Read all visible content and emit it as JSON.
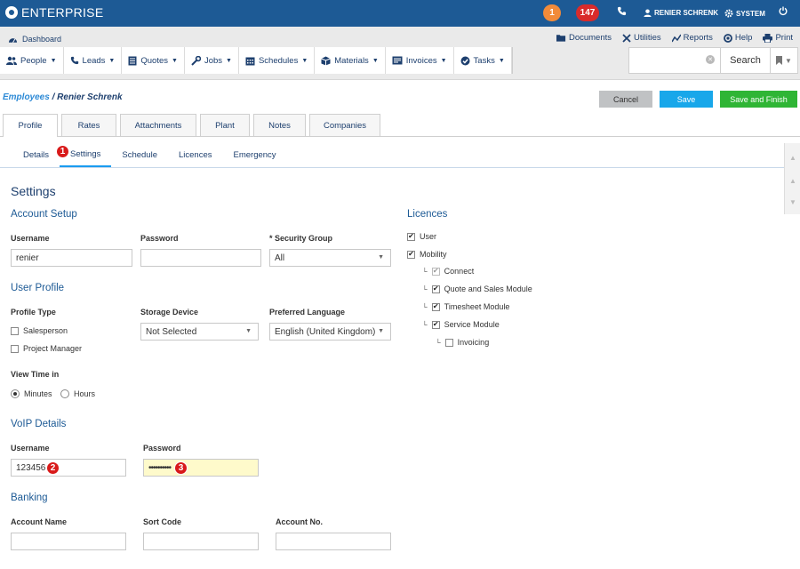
{
  "topbar": {
    "logo_text": "ENTERPRISE",
    "badge_orange": "1",
    "badge_red": "147",
    "user_name": "RENIER SCHRENK",
    "system_label": "SYSTEM",
    "colors": {
      "bar": "#1d5a95",
      "orange": "#f28b3a",
      "red": "#d92b2b"
    }
  },
  "toolbar": {
    "dashboard": "Dashboard",
    "links": [
      "Documents",
      "Utilities",
      "Reports",
      "Help",
      "Print"
    ],
    "nav": [
      "People",
      "Leads",
      "Quotes",
      "Jobs",
      "Schedules",
      "Materials",
      "Invoices",
      "Tasks"
    ],
    "search_label": "Search"
  },
  "breadcrumb": {
    "parent": "Employees",
    "separator": " / ",
    "current": "Renier Schrenk"
  },
  "actions": {
    "cancel": "Cancel",
    "save": "Save",
    "save_finish": "Save and Finish"
  },
  "tabs": [
    "Profile",
    "Rates",
    "Attachments",
    "Plant",
    "Notes",
    "Companies"
  ],
  "subtabs": [
    "Details",
    "Settings",
    "Schedule",
    "Licences",
    "Emergency"
  ],
  "markers": [
    "1",
    "2",
    "3"
  ],
  "settings": {
    "title": "Settings",
    "account_setup": {
      "heading": "Account Setup",
      "username_label": "Username",
      "username_value": "renier",
      "password_label": "Password",
      "password_value": "",
      "security_group_label": "* Security Group",
      "security_group_value": "All"
    },
    "user_profile": {
      "heading": "User Profile",
      "profile_type_label": "Profile Type",
      "profile_types": [
        "Salesperson",
        "Project Manager"
      ],
      "storage_label": "Storage Device",
      "storage_value": "Not Selected",
      "language_label": "Preferred Language",
      "language_value": "English (United Kingdom)",
      "view_time_label": "View Time in",
      "view_time_options": [
        "Minutes",
        "Hours"
      ],
      "view_time_selected": "Minutes"
    },
    "voip": {
      "heading": "VoIP Details",
      "username_label": "Username",
      "username_value": "123456",
      "password_label": "Password",
      "password_value": "••••••••••"
    },
    "banking": {
      "heading": "Banking",
      "account_name_label": "Account Name",
      "sort_code_label": "Sort Code",
      "account_no_label": "Account No."
    },
    "licences": {
      "heading": "Licences",
      "items": [
        {
          "label": "User",
          "checked": true
        },
        {
          "label": "Mobility",
          "checked": true
        },
        {
          "label": "Connect",
          "checked": true,
          "disabled": true
        },
        {
          "label": "Quote and Sales Module",
          "checked": true
        },
        {
          "label": "Timesheet Module",
          "checked": true
        },
        {
          "label": "Service Module",
          "checked": true
        },
        {
          "label": "Invoicing",
          "checked": false
        }
      ]
    }
  }
}
